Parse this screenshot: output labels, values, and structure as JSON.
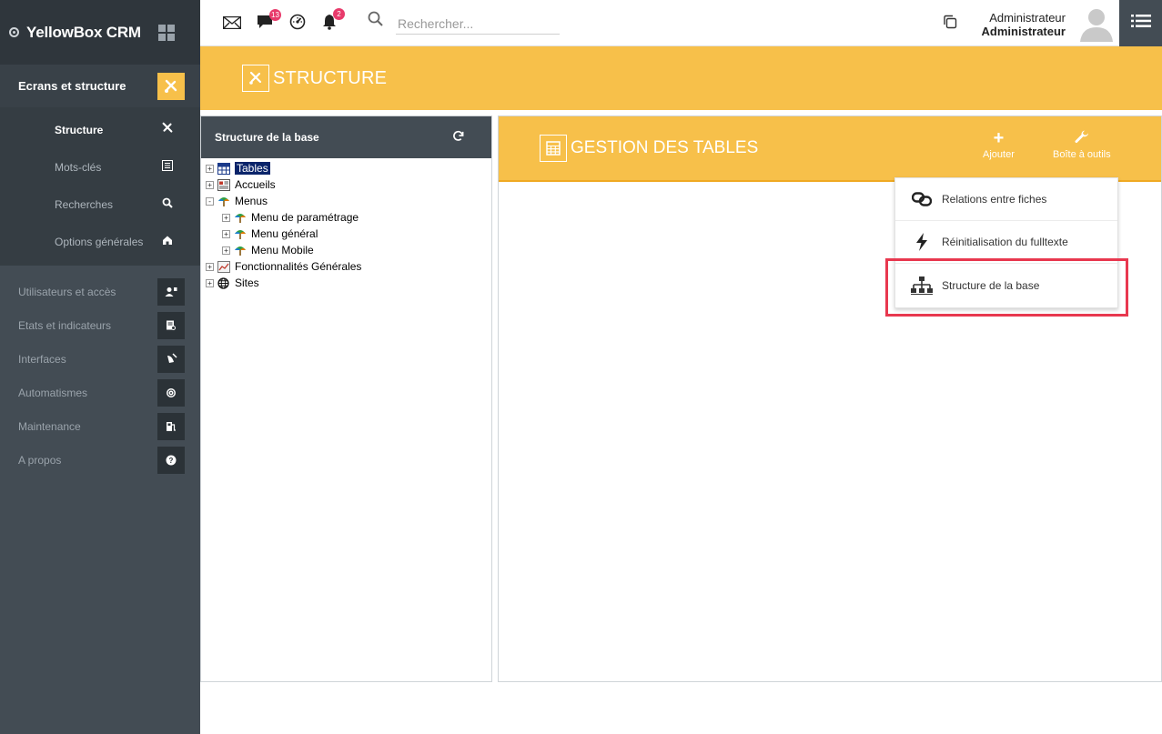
{
  "brand": {
    "name": "YellowBox CRM"
  },
  "sidebar": {
    "active_section": "Ecrans et structure",
    "subitems": [
      {
        "label": "Structure",
        "icon": "tools-icon",
        "active": true
      },
      {
        "label": "Mots-clés",
        "icon": "list-icon",
        "active": false
      },
      {
        "label": "Recherches",
        "icon": "search-icon",
        "active": false
      },
      {
        "label": "Options générales",
        "icon": "home-icon",
        "active": false
      }
    ],
    "sections": [
      {
        "label": "Utilisateurs et accès",
        "icon": "user-card-icon"
      },
      {
        "label": "Etats et indicateurs",
        "icon": "report-icon"
      },
      {
        "label": "Interfaces",
        "icon": "satellite-icon"
      },
      {
        "label": "Automatismes",
        "icon": "target-icon"
      },
      {
        "label": "Maintenance",
        "icon": "fuel-icon"
      },
      {
        "label": "A propos",
        "icon": "help-icon"
      }
    ]
  },
  "topbar": {
    "messages_badge": "13",
    "notifications_badge": "2",
    "search_placeholder": "Rechercher...",
    "user_name": "Administrateur",
    "user_role": "Administrateur"
  },
  "page": {
    "title": "STRUCTURE"
  },
  "left_panel": {
    "title": "Structure de la base",
    "tree": [
      {
        "label": "Tables",
        "selected": true,
        "level": 0,
        "expander": "+"
      },
      {
        "label": "Accueils",
        "level": 0,
        "expander": "+"
      },
      {
        "label": "Menus",
        "level": 0,
        "expander": "-"
      },
      {
        "label": "Menu de paramétrage",
        "level": 1,
        "expander": "+"
      },
      {
        "label": "Menu général",
        "level": 1,
        "expander": "+"
      },
      {
        "label": "Menu Mobile",
        "level": 1,
        "expander": "+"
      },
      {
        "label": "Fonctionnalités Générales",
        "level": 0,
        "expander": "+"
      },
      {
        "label": "Sites",
        "level": 0,
        "expander": "+"
      }
    ]
  },
  "right_panel": {
    "title": "GESTION DES TABLES",
    "add_label": "Ajouter",
    "tools_label": "Boîte à outils",
    "dropdown": [
      {
        "label": "Relations entre fiches",
        "icon": "link-icon"
      },
      {
        "label": "Réinitialisation du fulltexte",
        "icon": "lightning-icon"
      },
      {
        "label": "Structure de la base",
        "icon": "sitemap-icon"
      }
    ]
  },
  "colors": {
    "accent": "#f7c04a",
    "sidebar": "#434c54",
    "highlight": "#e8384f"
  }
}
